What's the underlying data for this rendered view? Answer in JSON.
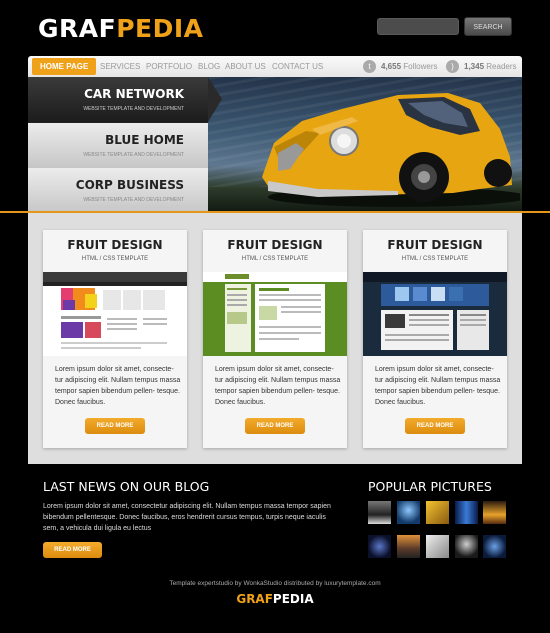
{
  "brand": {
    "logo_part1": "GRAF",
    "logo_part2": "PEDIA",
    "accent": "#f0a11a"
  },
  "search": {
    "button_label": "SEARCH"
  },
  "nav": {
    "items": [
      "HOME PAGE",
      "SERVICES",
      "PORTFOLIO",
      "BLOG",
      "ABOUT US",
      "CONTACT US"
    ],
    "active_index": 0,
    "twitter_count": "4,655",
    "twitter_label": "Followers",
    "rss_count": "1,345",
    "rss_label": "Readers",
    "twitter_icon": "twitter-icon",
    "rss_icon": "rss-icon"
  },
  "hero": {
    "tabs": [
      {
        "title": "CAR NETWORK",
        "subtitle": "WEBSITE TEMPLATE AND DEVELOPMENT"
      },
      {
        "title": "BLUE HOME",
        "subtitle": "WEBSITE TEMPLATE AND DEVELOPMENT"
      },
      {
        "title": "CORP BUSINESS",
        "subtitle": "WEBSITE TEMPLATE AND DEVELOPMENT"
      }
    ]
  },
  "cards": [
    {
      "title": "FRUIT DESIGN",
      "subtitle": "HTML / CSS TEMPLATE",
      "text": "Lorem ipsum dolor sit amet, consecte- tur adipiscing elit. Nullam tempus massa tempor sapien bibendum pellen- tesque. Donec faucibus.",
      "button": "READ MORE"
    },
    {
      "title": "FRUIT DESIGN",
      "subtitle": "HTML / CSS TEMPLATE",
      "text": "Lorem ipsum dolor sit amet, consecte- tur adipiscing elit. Nullam tempus massa tempor sapien bibendum pellen- tesque. Donec faucibus.",
      "button": "READ MORE"
    },
    {
      "title": "FRUIT DESIGN",
      "subtitle": "HTML / CSS TEMPLATE",
      "text": "Lorem ipsum dolor sit amet, consecte- tur adipiscing elit. Nullam tempus massa tempor sapien bibendum pellen- tesque. Donec faucibus.",
      "button": "READ MORE"
    }
  ],
  "news": {
    "title": "LAST NEWS ON OUR BLOG",
    "text": "Lorem ipsum dolor sit amet, consectetur adipiscing elit. Nullam tempus massa tempor sapien bibendum pellentesque. Donec faucibus, eros hendrerit cursus tempus, turpis neque iaculis sem, a vehicula dui ligula eu lectus",
    "button": "READ MORE"
  },
  "pictures": {
    "title": "POPULAR PICTURES"
  },
  "footer": {
    "credit": "Template expertstudio by WonkaStudio distributed by luxurytemplate.com",
    "logo_part1": "GRAF",
    "logo_part2": "PEDIA"
  }
}
